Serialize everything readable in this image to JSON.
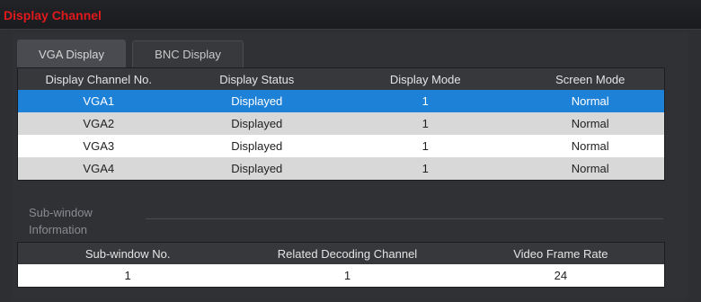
{
  "window": {
    "title": "Display Channel"
  },
  "tabs": [
    {
      "label": "VGA Display",
      "active": true
    },
    {
      "label": "BNC Display",
      "active": false
    }
  ],
  "display_table": {
    "columns": [
      "Display Channel No.",
      "Display Status",
      "Display Mode",
      "Screen Mode"
    ],
    "rows": [
      [
        "VGA1",
        "Displayed",
        "1",
        "Normal"
      ],
      [
        "VGA2",
        "Displayed",
        "1",
        "Normal"
      ],
      [
        "VGA3",
        "Displayed",
        "1",
        "Normal"
      ],
      [
        "VGA4",
        "Displayed",
        "1",
        "Normal"
      ]
    ],
    "selected_row": "VGA1"
  },
  "subwindow": {
    "section_label_line1": "Sub-window",
    "section_label_line2": "Information",
    "columns": [
      "Sub-window No.",
      "Related Decoding Channel",
      "Video Frame Rate"
    ],
    "rows": [
      [
        "1",
        "1",
        "24"
      ]
    ]
  },
  "colors": {
    "title_red": "#e0191d",
    "selection_blue": "#1e81d8",
    "background": "#2e2f33"
  }
}
